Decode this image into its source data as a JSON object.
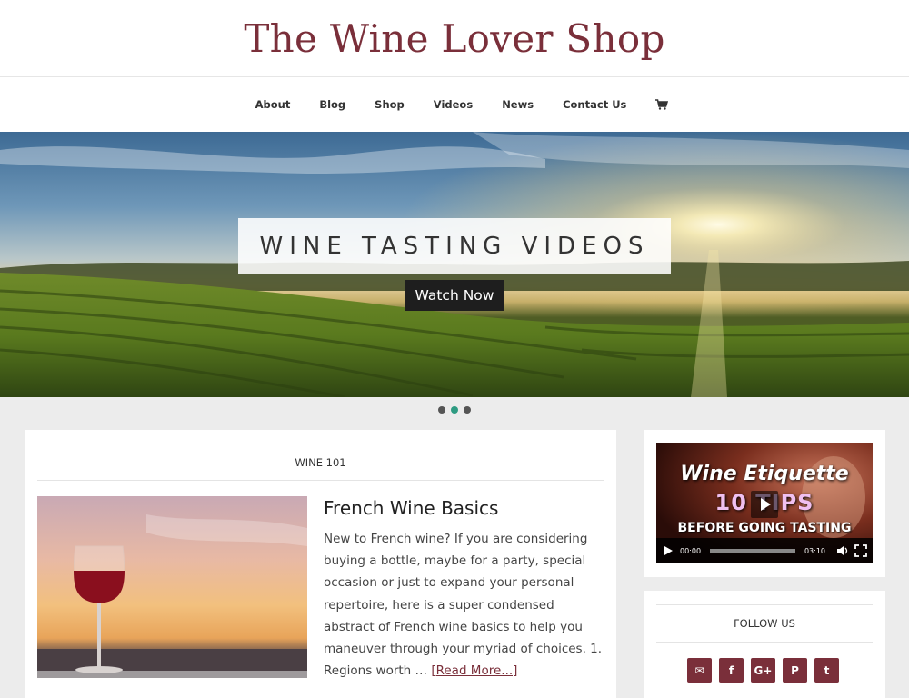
{
  "header": {
    "title": "The Wine Lover Shop"
  },
  "nav": {
    "items": [
      "About",
      "Blog",
      "Shop",
      "Videos",
      "News",
      "Contact Us"
    ],
    "cart_icon": "shopping-cart-icon"
  },
  "hero": {
    "title": "WINE TASTING VIDEOS",
    "button_label": "Watch Now",
    "slides_total": 3,
    "active_slide": 2
  },
  "main": {
    "category": "WINE 101",
    "post": {
      "title": "French Wine Basics",
      "excerpt": "New to French wine? If you are considering buying a bottle, maybe for a party, special occasion or just to expand your personal repertoire, here is a super condensed abstract of French wine basics to help you maneuver through your myriad of choices. 1. Regions worth … ",
      "read_more": "[Read More...]"
    }
  },
  "sidebar": {
    "video": {
      "title_line1": "Wine Etiquette",
      "title_line2": "10 TIPS",
      "title_line3": "BEFORE GOING TASTING",
      "current_time": "00:00",
      "duration": "03:10"
    },
    "follow": {
      "label": "FOLLOW US",
      "icons": [
        "email-icon",
        "facebook-icon",
        "google-plus-icon",
        "pinterest-icon",
        "twitter-icon"
      ],
      "glyphs": [
        "✉",
        "f",
        "G+",
        "P",
        "t"
      ]
    }
  },
  "colors": {
    "brand": "#7a2f3a",
    "slider_active": "#2e9b82",
    "page_bg": "#ececec"
  }
}
